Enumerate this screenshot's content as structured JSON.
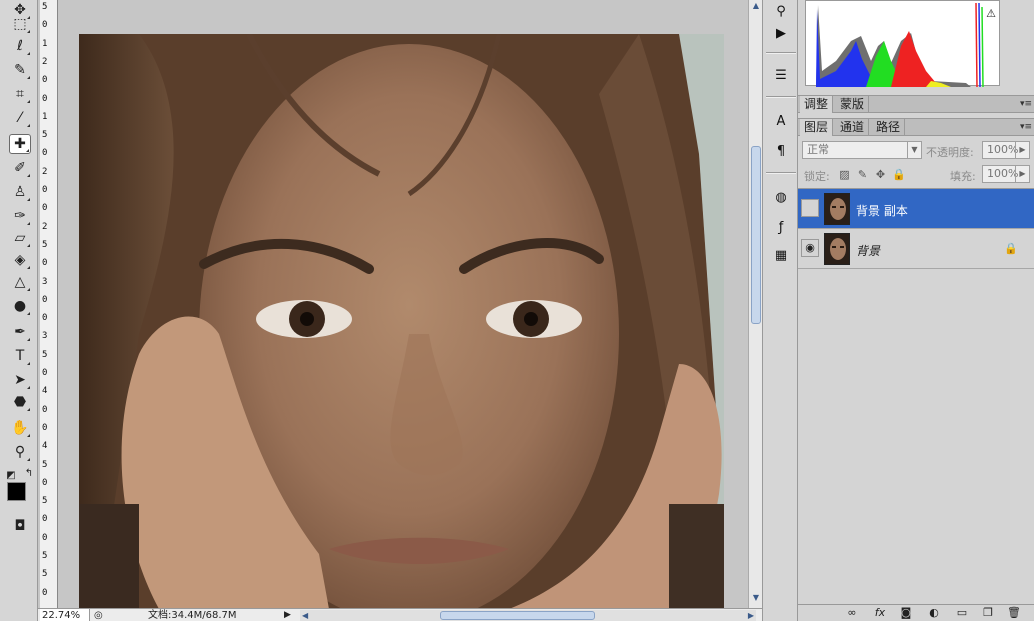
{
  "document": {
    "zoom": "22.74%",
    "doc_info": "文档:34.4M/68.7M",
    "ruler_labels": [
      "5",
      "0",
      "1",
      "2",
      "0",
      "0",
      "1",
      "5",
      "0",
      "2",
      "0",
      "0",
      "2",
      "5",
      "0",
      "3",
      "0",
      "0",
      "3",
      "5",
      "0",
      "4",
      "0",
      "0",
      "4",
      "5",
      "0",
      "5",
      "0",
      "0",
      "5",
      "5",
      "0"
    ]
  },
  "toolbox": {
    "tools": [
      {
        "name": "move-tool",
        "glyph": "✥"
      },
      {
        "name": "marquee-tool",
        "glyph": "⬚"
      },
      {
        "name": "lasso-tool",
        "glyph": "ℓ"
      },
      {
        "name": "quick-selection-tool",
        "glyph": "✎"
      },
      {
        "name": "crop-tool",
        "glyph": "⌗"
      },
      {
        "name": "eyedropper-tool",
        "glyph": "⁄"
      },
      {
        "name": "healing-brush-tool",
        "glyph": "✚",
        "active": true
      },
      {
        "name": "brush-tool",
        "glyph": "✐"
      },
      {
        "name": "clone-stamp-tool",
        "glyph": "♙"
      },
      {
        "name": "history-brush-tool",
        "glyph": "✑"
      },
      {
        "name": "eraser-tool",
        "glyph": "▱"
      },
      {
        "name": "paint-bucket-tool",
        "glyph": "◈"
      },
      {
        "name": "blur-tool",
        "glyph": "△"
      },
      {
        "name": "dodge-tool",
        "glyph": "●"
      },
      {
        "name": "pen-tool",
        "glyph": "✒"
      },
      {
        "name": "type-tool",
        "glyph": "T"
      },
      {
        "name": "path-selection-tool",
        "glyph": "➤"
      },
      {
        "name": "shape-tool",
        "glyph": "⬣"
      },
      {
        "name": "hand-tool",
        "glyph": "✋"
      },
      {
        "name": "zoom-tool",
        "glyph": "⚲"
      }
    ]
  },
  "panels": {
    "tabs_top": [
      {
        "label": "调整",
        "active": true
      },
      {
        "label": "蒙版",
        "active": false
      }
    ],
    "tabs_layers": [
      {
        "label": "图层",
        "active": true
      },
      {
        "label": "通道",
        "active": false
      },
      {
        "label": "路径",
        "active": false
      }
    ],
    "blend_mode": "正常",
    "opacity_label": "不透明度:",
    "opacity_value": "100%",
    "lock_label": "锁定:",
    "fill_label": "填充:",
    "fill_value": "100%",
    "layers": [
      {
        "name": "背景 副本",
        "selected": true,
        "visible": false,
        "italic": false,
        "locked": false
      },
      {
        "name": "背景",
        "selected": false,
        "visible": true,
        "italic": true,
        "locked": true
      }
    ]
  },
  "colors": {
    "selection": "#3167c4",
    "panel_bg": "#d4d4d4"
  }
}
